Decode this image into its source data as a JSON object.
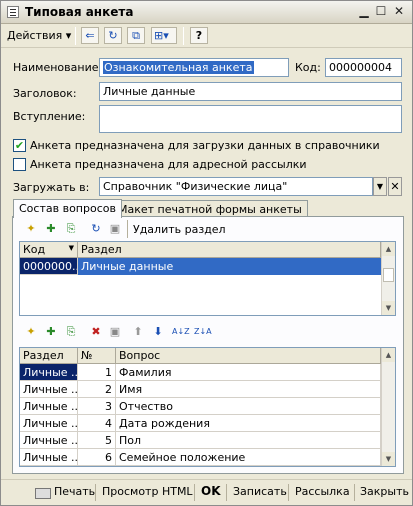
{
  "window": {
    "title": "Типовая анкета"
  },
  "toolbar": {
    "actions_label": "Действия ▾"
  },
  "form": {
    "name_label": "Наименование:",
    "name_value": "Ознакомительная анкета",
    "code_label": "Код:",
    "code_value": "000000004",
    "header_label": "Заголовок:",
    "header_value": "Личные данные",
    "intro_label": "Вступление:",
    "intro_value": "",
    "checkbox_directory_label": "Анкета предназначена для загрузки данных в справочники",
    "checkbox_directory_checked": true,
    "checkbox_mailing_label": "Анкета предназначена для адресной рассылки",
    "checkbox_mailing_checked": false,
    "load_to_label": "Загружать в:",
    "load_to_value": "Справочник \"Физические лица\""
  },
  "tabs": [
    {
      "label": "Состав вопросов",
      "active": true
    },
    {
      "label": "Макет печатной формы анкеты",
      "active": false
    }
  ],
  "sections": {
    "delete_label": "Удалить раздел",
    "columns": [
      "Код",
      "Раздел"
    ],
    "rows": [
      {
        "code": "0000000...",
        "name": "Личные данные"
      }
    ]
  },
  "questions": {
    "columns": [
      "Раздел",
      "№",
      "Вопрос"
    ],
    "rows": [
      {
        "section": "Личные ...",
        "num": "1",
        "question": "Фамилия"
      },
      {
        "section": "Личные ...",
        "num": "2",
        "question": "Имя"
      },
      {
        "section": "Личные ...",
        "num": "3",
        "question": "Отчество"
      },
      {
        "section": "Личные ...",
        "num": "4",
        "question": "Дата рождения"
      },
      {
        "section": "Личные ...",
        "num": "5",
        "question": "Пол"
      },
      {
        "section": "Личные ...",
        "num": "6",
        "question": "Семейное положение"
      }
    ]
  },
  "bottom": {
    "print": "Печать",
    "html_preview": "Просмотр HTML",
    "ok": "OK",
    "save": "Записать",
    "mailing": "Рассылка",
    "close": "Закрыть"
  },
  "colors": {
    "selection": "#316ac5",
    "selection_dark": "#0a246a",
    "field_border": "#7f9db9",
    "window_bg": "#ECE9D8"
  }
}
